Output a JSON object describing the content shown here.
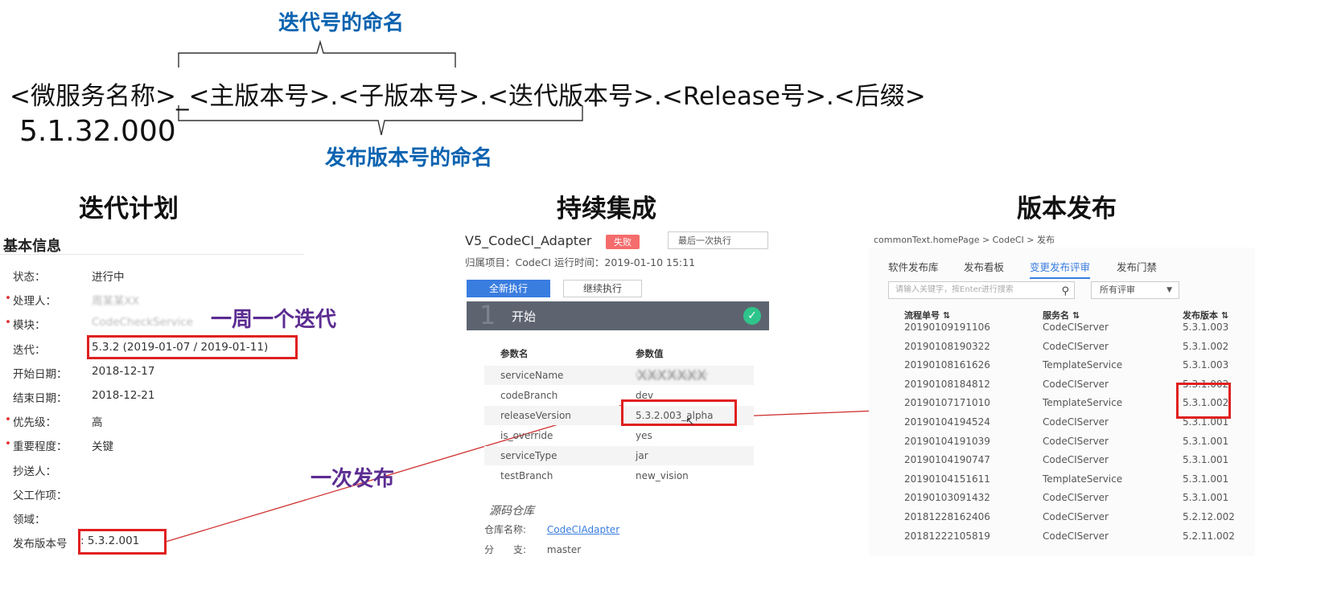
{
  "top": {
    "iteration_naming": "迭代号的命名",
    "formula": "<微服务名称>_<主版本号>.<子版本号>.<迭代版本号>.<Release号>.<后缀>",
    "example_version": "5.1.32.000",
    "release_naming": "发布版本号的命名"
  },
  "sections": {
    "iteration_plan": "迭代计划",
    "continuous_integration": "持续集成",
    "release": "版本发布"
  },
  "annotations": {
    "one_week_iteration": "一周一个迭代",
    "one_release": "一次发布"
  },
  "left_panel": {
    "heading": "基本信息",
    "rows": [
      {
        "label": "状态：",
        "value": "进行中",
        "required": false,
        "blurred": false
      },
      {
        "label": "处理人：",
        "value": "周某某XX",
        "required": true,
        "blurred": true
      },
      {
        "label": "模块：",
        "value": "CodeCheckService",
        "required": true,
        "blurred": true
      },
      {
        "label": "迭代：",
        "value": "5.3.2 (2019-01-07 / 2019-01-11)",
        "required": false,
        "blurred": false
      },
      {
        "label": "开始日期：",
        "value": "2018-12-17",
        "required": false,
        "blurred": false
      },
      {
        "label": "结束日期：",
        "value": "2018-12-21",
        "required": false,
        "blurred": false
      },
      {
        "label": "优先级：",
        "value": "高",
        "required": true,
        "blurred": false
      },
      {
        "label": "重要程度：",
        "value": "关键",
        "required": true,
        "blurred": false
      },
      {
        "label": "抄送人：",
        "value": "",
        "required": false,
        "blurred": false
      },
      {
        "label": "父工作项：",
        "value": "",
        "required": false,
        "blurred": false
      },
      {
        "label": "领域：",
        "value": "",
        "required": false,
        "blurred": false
      },
      {
        "label": "发布版本号",
        "value": ": 5.3.2.001",
        "required": false,
        "blurred": false
      }
    ]
  },
  "middle_panel": {
    "title": "V5_CodeCI_Adapter",
    "status_badge": "失败",
    "select_value": "最后一次执行",
    "meta": "归属项目：CodeCI     运行时间：2019-01-10 15:11",
    "btn_new_run": "全新执行",
    "btn_continue": "继续执行",
    "stage_number": "1",
    "stage_label": "开始",
    "stage_check": "✓",
    "param_header": {
      "name": "参数名",
      "value": "参数值"
    },
    "params": [
      {
        "name": "serviceName",
        "value": "CodeCIAdapter"
      },
      {
        "name": "codeBranch",
        "value": "dev"
      },
      {
        "name": "releaseVersion",
        "value": "5.3.2.003_alpha"
      },
      {
        "name": "is_override",
        "value": "yes"
      },
      {
        "name": "serviceType",
        "value": "jar"
      },
      {
        "name": "testBranch",
        "value": "new_vision"
      }
    ],
    "service_name_overlay": "XXXXXXX",
    "repo_title": "源码仓库",
    "repo_name_label": "仓库名称:",
    "repo_name_value": "CodeCIAdapter",
    "branch_label": "分　　支:",
    "branch_value": "master"
  },
  "right_panel": {
    "breadcrumb": "commonText.homePage  >  CodeCI  >  发布",
    "tabs": [
      "软件发布库",
      "发布看板",
      "变更发布评审",
      "发布门禁"
    ],
    "active_tab": 2,
    "search_placeholder": "请输入关键字，按Enter进行搜索",
    "filter_value": "所有评审",
    "columns": [
      "流程单号 ⇅",
      "服务名 ⇅",
      "发布版本 ⇅"
    ],
    "rows": [
      [
        "20190109191106",
        "CodeCIServer",
        "5.3.1.003"
      ],
      [
        "20190108190322",
        "CodeCIServer",
        "5.3.1.002"
      ],
      [
        "20190108161626",
        "TemplateService",
        "5.3.1.003"
      ],
      [
        "20190108184812",
        "CodeCIServer",
        "5.3.1.002"
      ],
      [
        "20190107171010",
        "TemplateService",
        "5.3.1.002"
      ],
      [
        "20190104194524",
        "CodeCIServer",
        "5.3.1.001"
      ],
      [
        "20190104191039",
        "CodeCIServer",
        "5.3.1.001"
      ],
      [
        "20190104190747",
        "CodeCIServer",
        "5.3.1.001"
      ],
      [
        "20190104151611",
        "TemplateService",
        "5.3.1.001"
      ],
      [
        "20190103091432",
        "CodeCIServer",
        "5.3.1.001"
      ],
      [
        "20181228162406",
        "CodeCIServer",
        "5.2.12.002"
      ],
      [
        "20181222105819",
        "CodeCIServer",
        "5.2.11.002"
      ]
    ]
  },
  "colors": {
    "annotation_blue": "#0a63b0",
    "annotation_purple": "#5b2c91",
    "highlight_red": "#e02020",
    "primary_blue": "#3a7de0",
    "success_green": "#2fc58a"
  }
}
